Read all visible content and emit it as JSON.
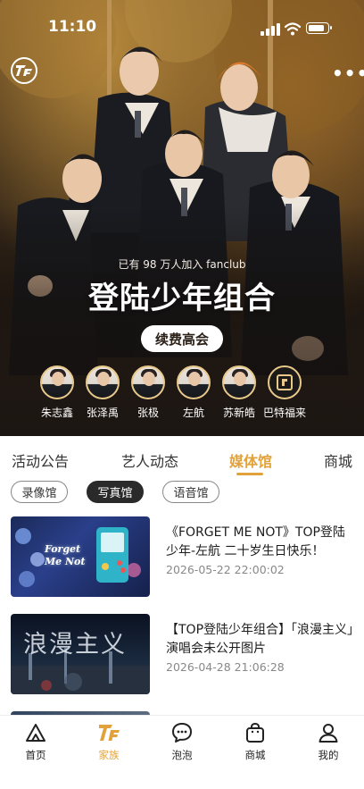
{
  "status": {
    "time": "11:10"
  },
  "hero": {
    "joined_text": "已有 98 万人加入 fanclub",
    "group_name": "登陆少年组合",
    "renew_label": "续费高会",
    "more_label": "•••",
    "members": [
      {
        "name": "朱志鑫"
      },
      {
        "name": "张泽禹"
      },
      {
        "name": "张极"
      },
      {
        "name": "左航"
      },
      {
        "name": "苏新皓"
      },
      {
        "name": "巴特福来"
      }
    ]
  },
  "tabs": {
    "items": [
      {
        "label": "活动公告"
      },
      {
        "label": "艺人动态"
      },
      {
        "label": "媒体馆"
      },
      {
        "label": "商城"
      }
    ],
    "active": "媒体馆"
  },
  "chips": {
    "items": [
      {
        "label": "录像馆"
      },
      {
        "label": "写真馆"
      },
      {
        "label": "语音馆"
      }
    ],
    "active": "写真馆"
  },
  "posts": [
    {
      "title": "《FORGET ME NOT》TOP登陆少年-左航 二十岁生日快乐！",
      "date": "2026-05-22 22:00:02",
      "thumb_text": "Forget Me Not"
    },
    {
      "title": "【TOP登陆少年组合】「浪漫主义」演唱会未公开图片",
      "date": "2026-04-28 21:06:28",
      "thumb_text": "浪漫主义"
    }
  ],
  "bottom_nav": {
    "items": [
      {
        "label": "首页",
        "icon": "home-mountain-icon"
      },
      {
        "label": "家族",
        "icon": "tf-logo-icon"
      },
      {
        "label": "泡泡",
        "icon": "chat-bubble-icon"
      },
      {
        "label": "商城",
        "icon": "shopping-bag-icon"
      },
      {
        "label": "我的",
        "icon": "profile-icon"
      }
    ],
    "active": "家族"
  },
  "colors": {
    "accent": "#e2a23b",
    "chip_active": "#2a2a2a"
  }
}
